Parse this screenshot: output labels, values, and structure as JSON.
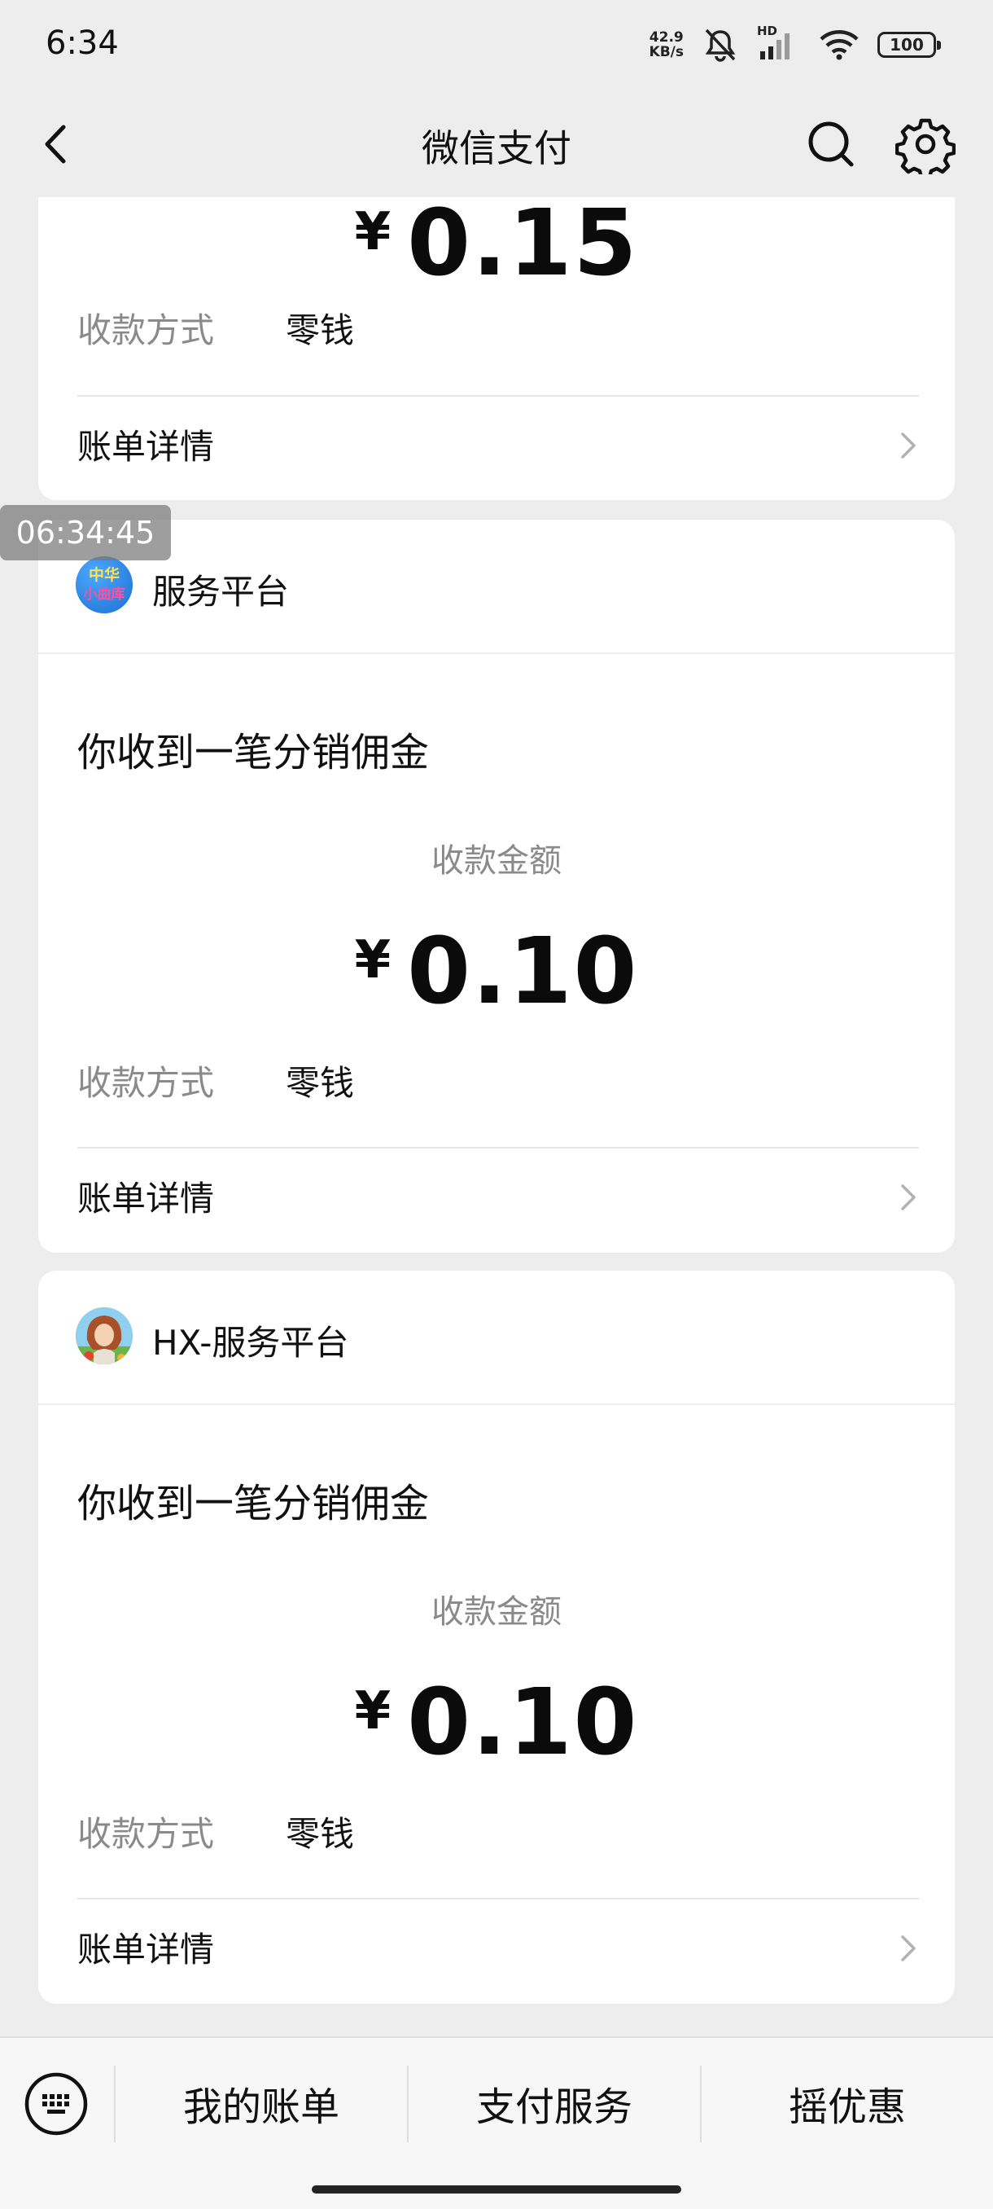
{
  "status_bar": {
    "time": "6:34",
    "net_speed_value": "42.9",
    "net_speed_unit": "KB/s",
    "network_label": "HD",
    "battery": "100",
    "icons": [
      "mute-icon",
      "signal-icon",
      "wifi-icon",
      "battery-icon"
    ]
  },
  "nav": {
    "title": "微信支付",
    "icons": [
      "back-icon",
      "search-icon",
      "settings-icon"
    ]
  },
  "timestamp": "06:34:45",
  "cards": [
    {
      "amount_currency": "¥",
      "amount_value": "0.15",
      "pay_method_label": "收款方式",
      "pay_method_value": "零钱",
      "detail_label": "账单详情"
    },
    {
      "sender": "服务平台",
      "avatar_text_line1": "中华",
      "avatar_text_line2": "小曲库",
      "headline": "你收到一笔分销佣金",
      "amount_label": "收款金额",
      "amount_currency": "¥",
      "amount_value": "0.10",
      "pay_method_label": "收款方式",
      "pay_method_value": "零钱",
      "detail_label": "账单详情"
    },
    {
      "sender": "HX-服务平台",
      "headline": "你收到一笔分销佣金",
      "amount_label": "收款金额",
      "amount_currency": "¥",
      "amount_value": "0.10",
      "pay_method_label": "收款方式",
      "pay_method_value": "零钱",
      "detail_label": "账单详情"
    }
  ],
  "bottom_menu": {
    "items": [
      "我的账单",
      "支付服务",
      "摇优惠"
    ],
    "keyboard_icon": "keyboard-icon"
  },
  "colors": {
    "background": "#ededed",
    "card": "#ffffff",
    "secondary_text": "#8a8a8a",
    "primary_text": "#111111"
  }
}
